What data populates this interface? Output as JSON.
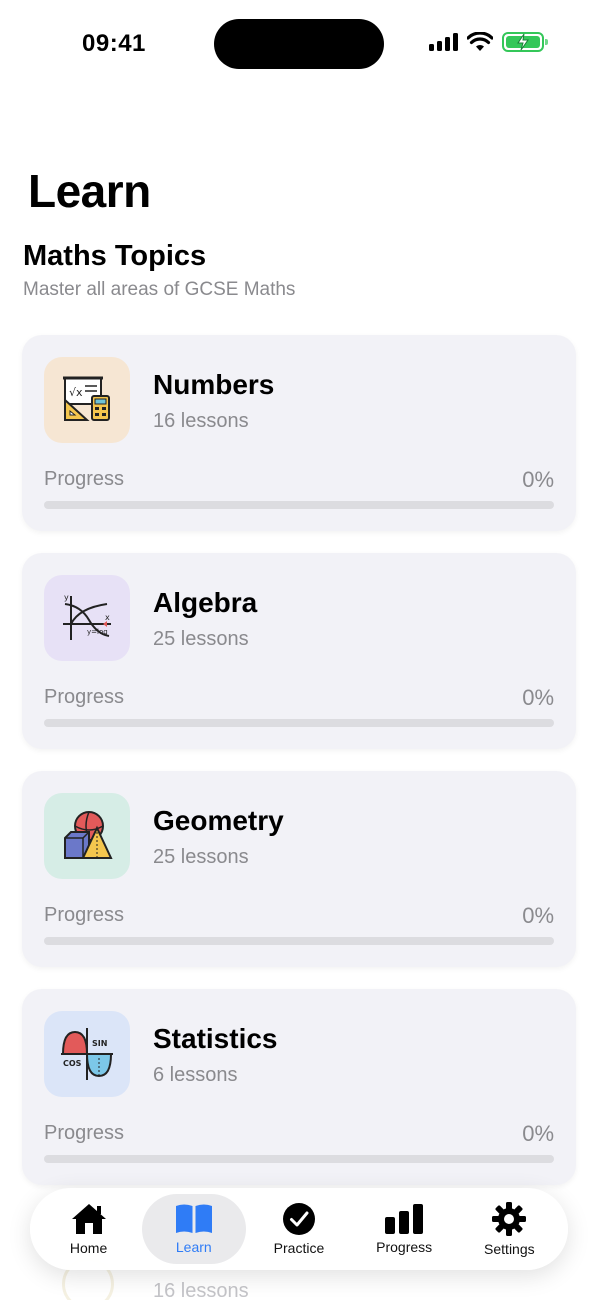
{
  "status_bar": {
    "time": "09:41"
  },
  "header": {
    "title": "Learn"
  },
  "section": {
    "title": "Maths Topics",
    "subtitle": "Master all areas of GCSE Maths"
  },
  "topics": [
    {
      "title": "Numbers",
      "lessons": "16 lessons",
      "progress_label": "Progress",
      "progress_value": "0%",
      "progress": 0,
      "icon": "calculator-geometry-icon",
      "icon_bg": "#f6e6d3"
    },
    {
      "title": "Algebra",
      "lessons": "25 lessons",
      "progress_label": "Progress",
      "progress_value": "0%",
      "progress": 0,
      "icon": "graph-function-icon",
      "icon_bg": "#e7e1f6"
    },
    {
      "title": "Geometry",
      "lessons": "25 lessons",
      "progress_label": "Progress",
      "progress_value": "0%",
      "progress": 0,
      "icon": "shapes-icon",
      "icon_bg": "#d6ede6"
    },
    {
      "title": "Statistics",
      "lessons": "6 lessons",
      "progress_label": "Progress",
      "progress_value": "0%",
      "progress": 0,
      "icon": "sine-cosine-icon",
      "icon_bg": "#dbe5f8"
    }
  ],
  "next_topic_partial": {
    "lessons": "16 lessons"
  },
  "tab_bar": {
    "accent": "#2f7cf6",
    "tabs": [
      {
        "label": "Home",
        "icon": "house-icon",
        "active": false
      },
      {
        "label": "Learn",
        "icon": "book-icon",
        "active": true
      },
      {
        "label": "Practice",
        "icon": "checkmark-circle-icon",
        "active": false
      },
      {
        "label": "Progress",
        "icon": "bar-chart-icon",
        "active": false
      },
      {
        "label": "Settings",
        "icon": "gear-icon",
        "active": false
      }
    ]
  }
}
